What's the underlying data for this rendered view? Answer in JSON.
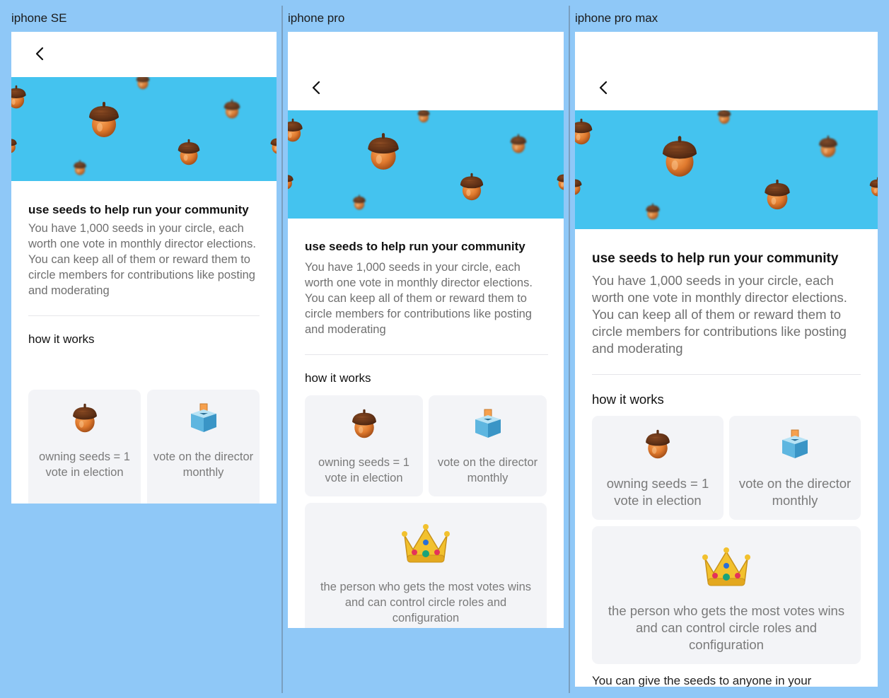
{
  "frames": [
    {
      "label": "iphone SE"
    },
    {
      "label": "iphone pro"
    },
    {
      "label": "iphone pro max"
    }
  ],
  "content": {
    "title": "use seeds to help run your community",
    "description": "You have 1,000 seeds in your circle, each worth one vote in monthly director elections. You can keep all of them or reward them to circle members for contributions like posting and moderating",
    "how_heading": "how it works",
    "cards": {
      "owning": "owning seeds = 1 vote in election",
      "vote": "vote on the director monthly",
      "crown": "the person who gets the most votes wins and can control circle roles and configuration"
    },
    "more_text": "You can give the seeds to anyone in your"
  },
  "colors": {
    "page_bg": "#8fc8f7",
    "hero_bg": "#44c3ef",
    "card_bg": "#f3f4f7",
    "text_muted": "#6f6f6f"
  },
  "icons": {
    "back": "chevron-left-icon",
    "acorn": "acorn-icon",
    "ballot": "ballot-box-icon",
    "crown": "crown-icon"
  }
}
